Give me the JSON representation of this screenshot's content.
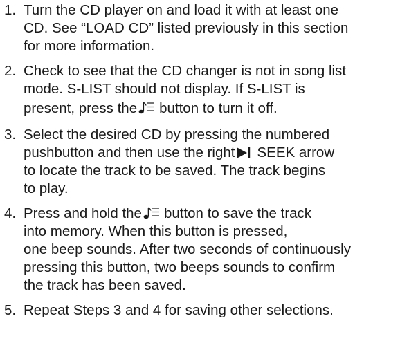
{
  "steps": [
    {
      "number": "1.",
      "lines": [
        "Turn the CD player on and load it with at least one",
        "CD. See “LOAD CD” listed previously in this section",
        "for more information."
      ]
    },
    {
      "number": "2.",
      "lines": [
        "Check to see that the CD changer is not in song list",
        "mode. S-LIST should not display. If S-LIST is"
      ],
      "line3_before": "present, press the",
      "line3_after": "button to turn it off."
    },
    {
      "number": "3.",
      "line1": "Select the desired CD by pressing the numbered",
      "line2_before": "pushbutton and then use the right",
      "line2_after": "SEEK arrow",
      "lines_rest": [
        "to locate the track to be saved. The track begins",
        "to play."
      ]
    },
    {
      "number": "4.",
      "line1_before": "Press and hold the",
      "line1_after": "button to save the track",
      "lines_rest": [
        "into memory. When this button is pressed,",
        "one beep sounds. After two seconds of continuously",
        "pressing this button, two beeps sounds to confirm",
        "the track has been saved."
      ]
    },
    {
      "number": "5.",
      "lines": [
        "Repeat Steps 3 and 4 for saving other selections."
      ]
    }
  ],
  "icons": {
    "song_list": "song-list-icon",
    "seek_right": "seek-right-icon"
  }
}
